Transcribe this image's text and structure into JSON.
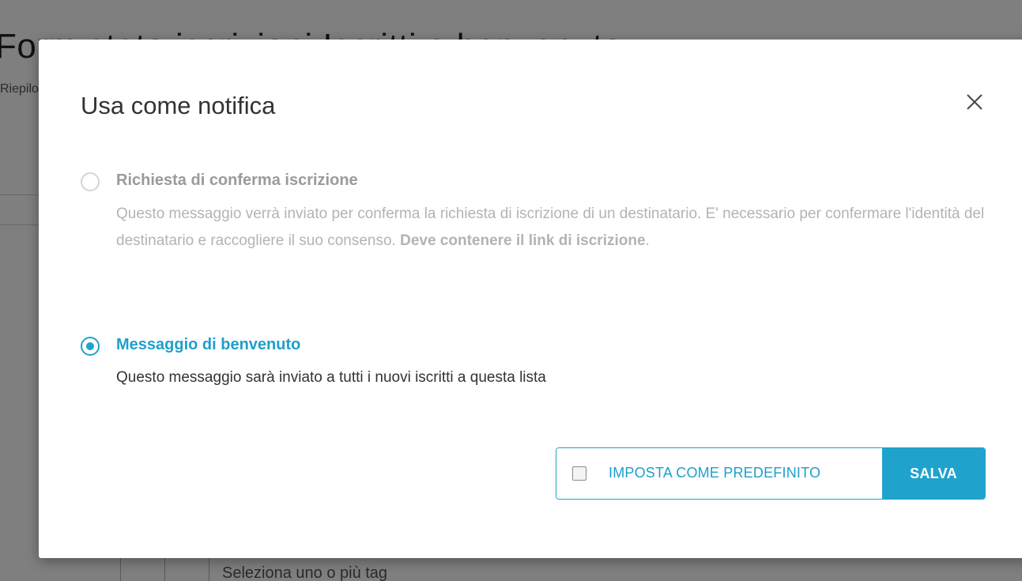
{
  "background": {
    "title": "Form stato iscrizioni Iscritti e benvenuto",
    "subtitle": "Riepilogo",
    "tags_placeholder": "Seleziona uno o più tag"
  },
  "modal": {
    "title": "Usa come notifica",
    "close_icon": "close-icon",
    "options": [
      {
        "label": "Richiesta di conferma iscrizione",
        "selected": false,
        "disabled": true,
        "description_before": "Questo messaggio verrà inviato per conferma la richiesta di iscrizione di un destinatario. E' necessario per confermare l'identità del destinatario e raccogliere il suo consenso. ",
        "description_bold": "Deve contenere il link di iscrizione",
        "description_after": "."
      },
      {
        "label": "Messaggio di benvenuto",
        "selected": true,
        "disabled": false,
        "description": "Questo messaggio sarà inviato a tutti i nuovi iscritti a questa lista"
      }
    ],
    "set_default_label": "IMPOSTA COME PREDEFINITO",
    "set_default_checked": false,
    "save_label": "SALVA"
  },
  "colors": {
    "accent": "#1fa2cc",
    "overlay": "rgba(0,0,0,0.5)",
    "disabled_text": "#b3b3b3"
  }
}
